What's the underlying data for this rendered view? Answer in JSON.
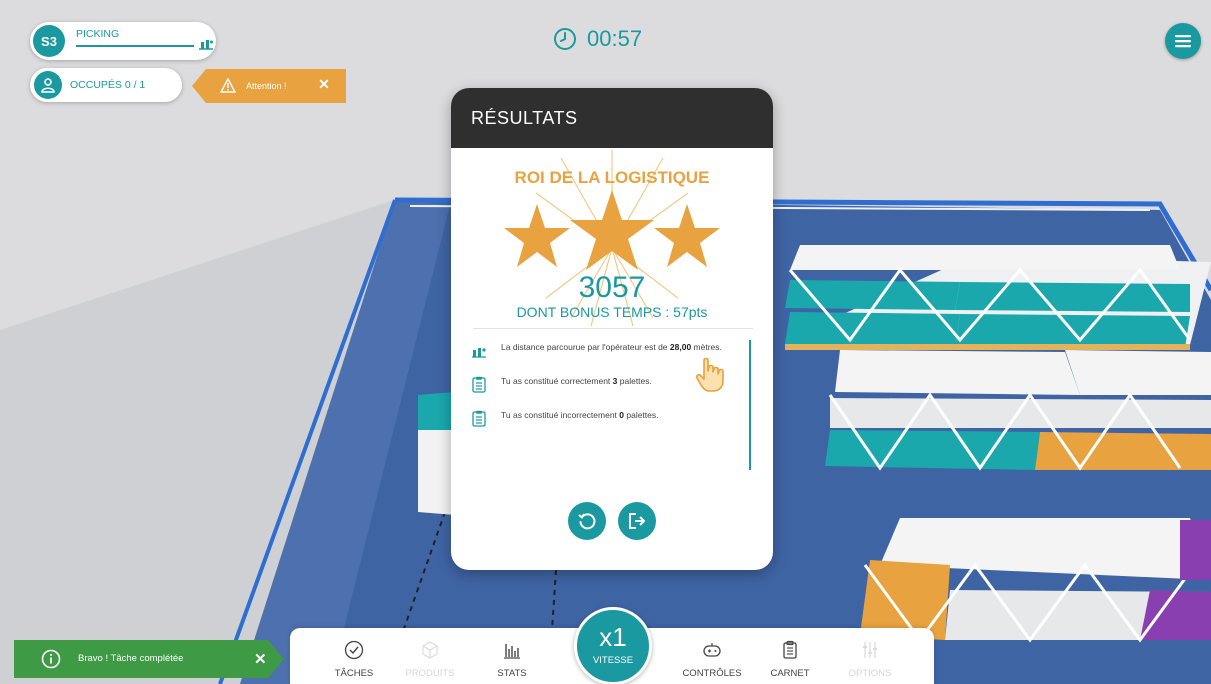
{
  "hud": {
    "station": {
      "badge": "S3",
      "label": "PICKING",
      "progress": 1.0
    },
    "occupied": {
      "label": "OCCUPÉS 0 / 1"
    },
    "alert": {
      "label": "Attention !",
      "close": "✕"
    },
    "timer": "00:57",
    "menu_icon": "hamburger-icon"
  },
  "results": {
    "title": "RÉSULTATS",
    "rank": "ROI DE LA LOGISTIQUE",
    "stars": 3,
    "score": "3057",
    "bonus": "DONT BONUS TEMPS : 57pts",
    "stats": [
      {
        "icon": "distance-icon",
        "prefix": "La distance parcourue par l'opérateur est de ",
        "value": "28,00",
        "suffix": " mètres."
      },
      {
        "icon": "clipboard-icon",
        "prefix": "Tu as constitué correctement ",
        "value": "3",
        "suffix": " palettes."
      },
      {
        "icon": "clipboard-icon",
        "prefix": "Tu as constitué incorrectement ",
        "value": "0",
        "suffix": " palettes."
      }
    ],
    "buttons": [
      "restart-icon",
      "exit-icon"
    ]
  },
  "toolbar": {
    "items": [
      {
        "label": "TÂCHES",
        "icon": "check-circle-icon",
        "enabled": true
      },
      {
        "label": "PRODUITS",
        "icon": "box-icon",
        "enabled": false
      },
      {
        "label": "STATS",
        "icon": "bar-chart-icon",
        "enabled": true
      },
      {
        "label": "CONTRÔLES",
        "icon": "gamepad-icon",
        "enabled": true
      },
      {
        "label": "CARNET",
        "icon": "notebook-icon",
        "enabled": true
      },
      {
        "label": "OPTIONS",
        "icon": "sliders-icon",
        "enabled": false
      }
    ],
    "speed": {
      "value": "x1",
      "label": "VITESSE"
    }
  },
  "toast": {
    "label": "Bravo ! Tâche complétée",
    "close": "✕"
  },
  "colors": {
    "accent": "#1a9aa0",
    "gold": "#e8a23f",
    "success": "#3f9a45",
    "header": "#2f2f2f"
  }
}
